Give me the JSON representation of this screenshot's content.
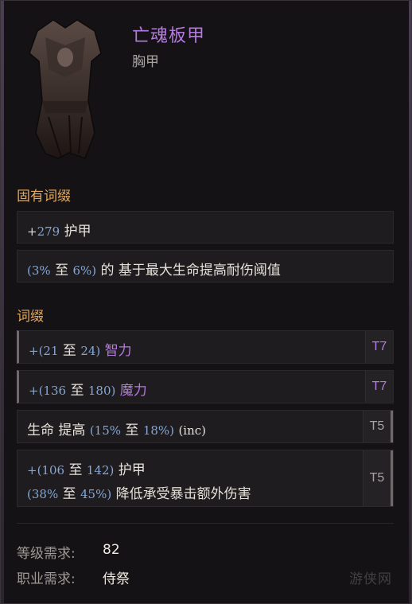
{
  "item": {
    "name": "亡魂板甲",
    "type": "胸甲",
    "art_icon": "chest-armor-icon"
  },
  "implicit": {
    "title": "固有词缀",
    "rows": [
      {
        "plus": "+",
        "num": "279",
        "label": "护甲"
      },
      {
        "open": "(",
        "a": "3%",
        "to": "至",
        "b": "6%",
        "close": ")",
        "label": "的 基于最大生命提高耐伤阈值"
      }
    ]
  },
  "affixes": {
    "title": "词缀",
    "rows": [
      {
        "prefix": "+(",
        "a": "21",
        "to": "至",
        "b": "24",
        "close": ")",
        "label": "智力",
        "tier": "T7"
      },
      {
        "prefix": "+(",
        "a": "136",
        "to": "至",
        "b": "180",
        "close": ")",
        "label": "魔力",
        "tier": "T7"
      },
      {
        "pre_label": "生命 提高",
        "open": "(",
        "a": "15%",
        "to": "至",
        "b": "18%",
        "close": ")",
        "suffix": "(inc)",
        "tier": "T5"
      },
      {
        "line1": {
          "prefix": "+(",
          "a": "106",
          "to": "至",
          "b": "142",
          "close": ")",
          "label": "护甲"
        },
        "line2": {
          "open": "(",
          "a": "38%",
          "to": "至",
          "b": "45%",
          "close": ")",
          "label": "降低承受暴击额外伤害"
        },
        "tier": "T5"
      }
    ]
  },
  "requirements": [
    {
      "label": "等级需求:",
      "value": "82"
    },
    {
      "label": "职业需求:",
      "value": "侍祭"
    }
  ],
  "watermark": "游侠网",
  "colors": {
    "name": "#b57ae0",
    "section": "#e4a95e",
    "number": "#84a7d6",
    "tier_high": "#b57ae0",
    "tier_mid": "#a8a3a0"
  }
}
